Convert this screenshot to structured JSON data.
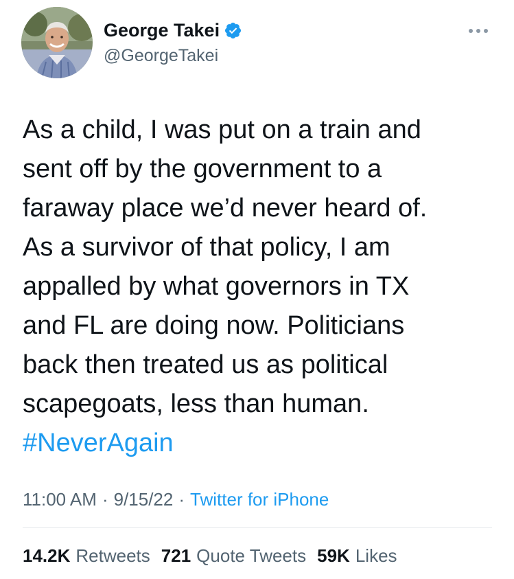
{
  "author": {
    "display_name": "George Takei",
    "handle": "@GeorgeTakei",
    "verified_icon": "verified-badge-icon",
    "avatar": "profile-photo"
  },
  "tweet": {
    "lines": [
      "As a child, I was put on a train and",
      "sent off by the government to a",
      "faraway place we’d never heard of.",
      "As a survivor of that policy, I am",
      "appalled by what governors in TX",
      "and FL are doing now. Politicians",
      "back then treated us as political",
      "scapegoats, less than human."
    ],
    "hashtag": "#NeverAgain"
  },
  "meta": {
    "time": "11:00 AM",
    "separator": "·",
    "date": "9/15/22",
    "source": "Twitter for iPhone"
  },
  "stats": {
    "retweets_count": "14.2K",
    "retweets_label": "Retweets",
    "quotes_count": "721",
    "quotes_label": "Quote Tweets",
    "likes_count": "59K",
    "likes_label": "Likes"
  },
  "colors": {
    "link": "#1d9bf0",
    "text": "#0f1419",
    "secondary": "#536471",
    "divider": "#e4e8eb"
  }
}
